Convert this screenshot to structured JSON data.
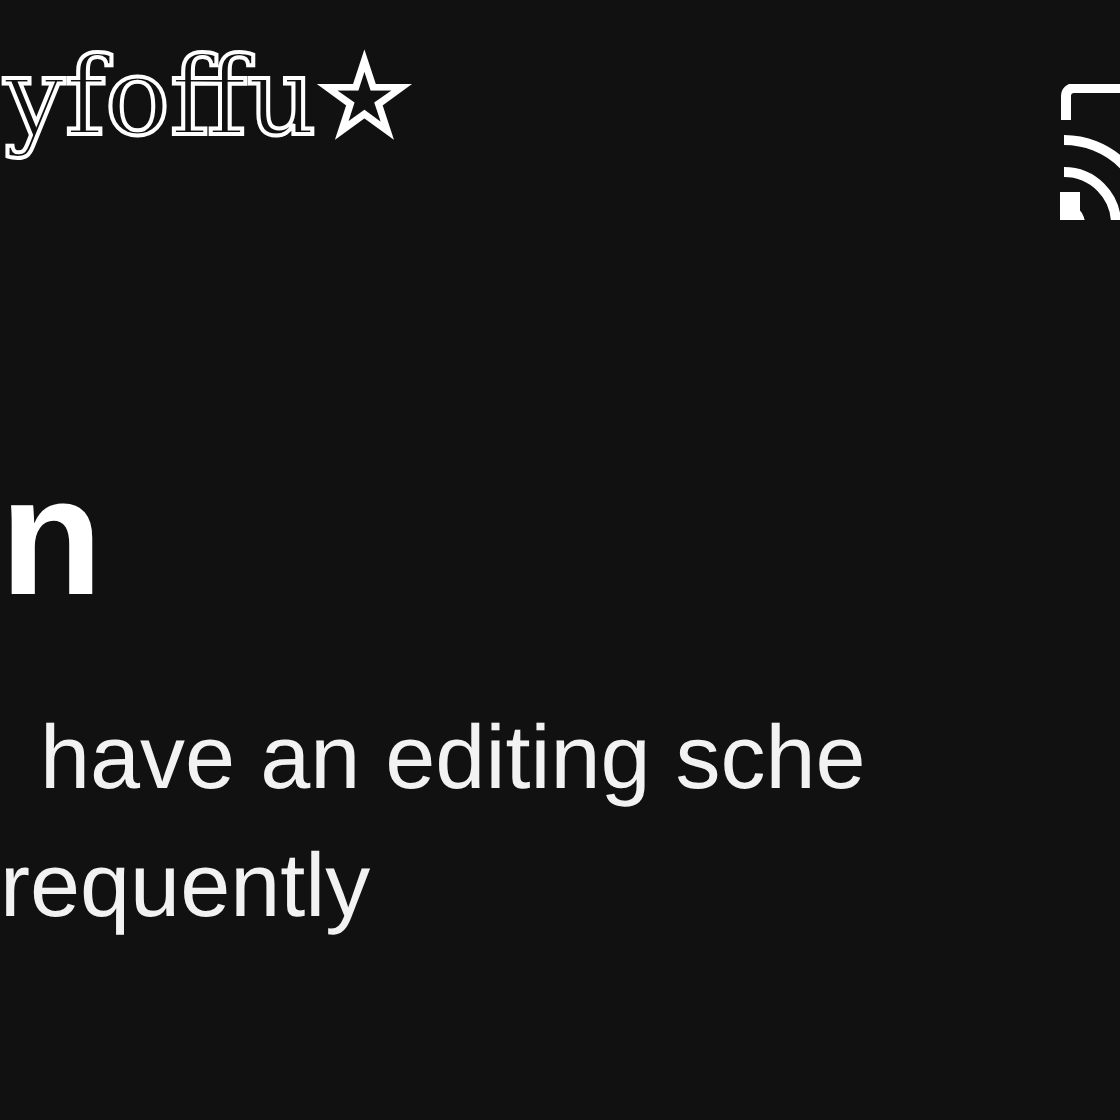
{
  "header": {
    "logo": "yfoffu☆"
  },
  "title": "n",
  "body_lines": [
    "have an editing sche",
    "requently"
  ]
}
